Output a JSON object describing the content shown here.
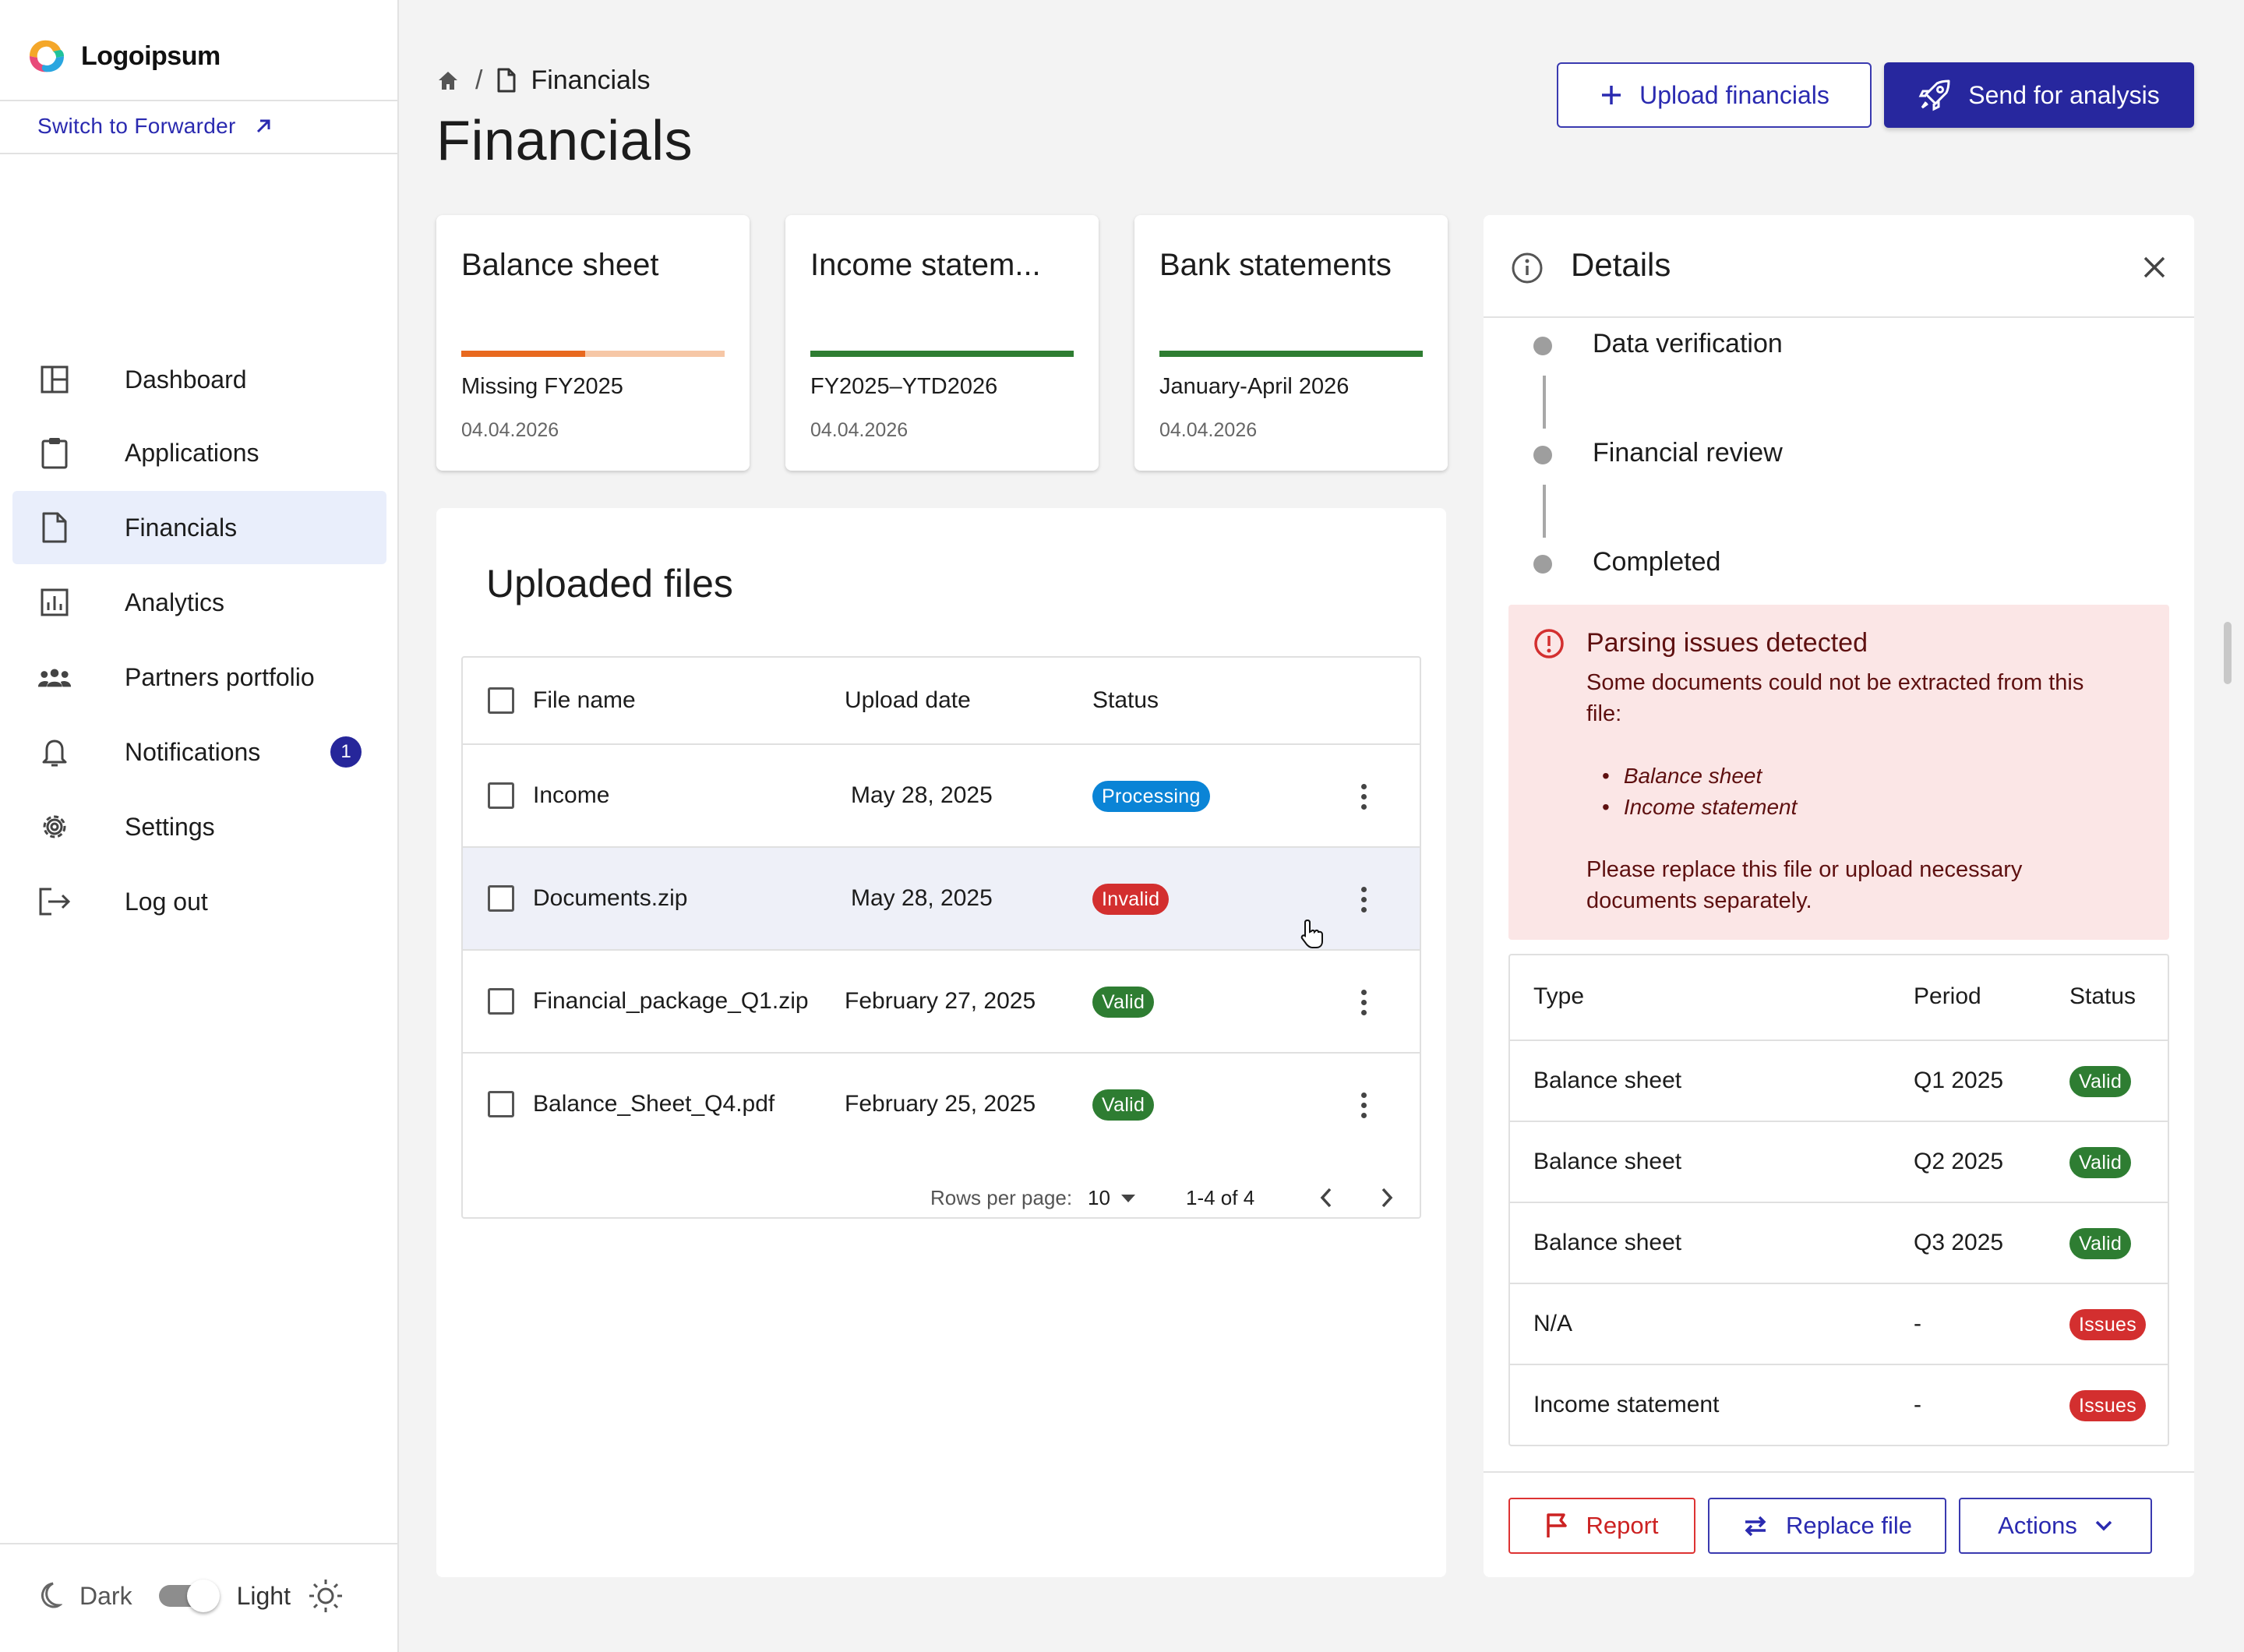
{
  "brand": {
    "name": "Logoipsum",
    "switch_label": "Switch to Forwarder"
  },
  "sidebar": {
    "items": [
      {
        "label": "Dashboard",
        "icon": "dashboard-icon"
      },
      {
        "label": "Applications",
        "icon": "clipboard-icon"
      },
      {
        "label": "Financials",
        "icon": "document-icon",
        "active": true
      },
      {
        "label": "Analytics",
        "icon": "bar-chart-icon"
      },
      {
        "label": "Partners portfolio",
        "icon": "group-icon"
      },
      {
        "label": "Notifications",
        "icon": "bell-icon",
        "badge": "1"
      },
      {
        "label": "Settings",
        "icon": "gear-icon"
      },
      {
        "label": "Log out",
        "icon": "logout-icon"
      }
    ],
    "theme": {
      "dark_label": "Dark",
      "light_label": "Light",
      "mode": "light"
    }
  },
  "header": {
    "breadcrumb_sep": "/",
    "breadcrumb_current": "Financials",
    "title": "Financials",
    "upload_label": "Upload financials",
    "send_label": "Send for analysis"
  },
  "cards": [
    {
      "title": "Balance sheet",
      "subtitle": "Missing FY2025",
      "date": "04.04.2026",
      "progress": 0.47,
      "color": "#e8691f",
      "track": "#f6c7a6"
    },
    {
      "title": "Income statem...",
      "subtitle": "FY2025–YTD2026",
      "date": "04.04.2026",
      "progress": 1.0,
      "color": "#2e7d32",
      "track": "#2e7d32"
    },
    {
      "title": "Bank statements",
      "subtitle": "January-April 2026",
      "date": "04.04.2026",
      "progress": 1.0,
      "color": "#2e7d32",
      "track": "#2e7d32"
    }
  ],
  "files": {
    "title": "Uploaded files",
    "columns": {
      "name": "File name",
      "date": "Upload date",
      "status": "Status"
    },
    "rows": [
      {
        "name": "Income",
        "date": "May 28, 2025",
        "status": "Processing",
        "status_color": "#0a84d6"
      },
      {
        "name": "Documents.zip",
        "date": "May 28, 2025",
        "status": "Invalid",
        "status_color": "#d32f2f"
      },
      {
        "name": "Financial_package_Q1.zip",
        "date": "February 27, 2025",
        "status": "Valid",
        "status_color": "#2e7d32"
      },
      {
        "name": "Balance_Sheet_Q4.pdf",
        "date": "February 25, 2025",
        "status": "Valid",
        "status_color": "#2e7d32"
      }
    ],
    "pager": {
      "rows_per_page_label": "Rows per page:",
      "rows_per_page": "10",
      "range": "1-4 of 4"
    }
  },
  "details": {
    "title": "Details",
    "steps": [
      "Data verification",
      "Financial review",
      "Completed"
    ],
    "alert": {
      "title": "Parsing issues detected",
      "text_line1": "Some documents could not be extracted from this",
      "text_line2": "file:",
      "items": [
        "Balance sheet",
        "Income statement"
      ],
      "footer_line1": "Please replace this file or upload necessary",
      "footer_line2": "documents separately."
    },
    "table": {
      "columns": {
        "type": "Type",
        "period": "Period",
        "status": "Status"
      },
      "rows": [
        {
          "type": "Balance sheet",
          "period": "Q1 2025",
          "status": "Valid",
          "status_color": "#2e7d32"
        },
        {
          "type": "Balance sheet",
          "period": "Q2 2025",
          "status": "Valid",
          "status_color": "#2e7d32"
        },
        {
          "type": "Balance sheet",
          "period": "Q3 2025",
          "status": "Valid",
          "status_color": "#2e7d32"
        },
        {
          "type": "N/A",
          "period": "-",
          "status": "Issues",
          "status_color": "#d32f2f"
        },
        {
          "type": "Income statement",
          "period": "-",
          "status": "Issues",
          "status_color": "#d32f2f"
        }
      ]
    },
    "actions": {
      "report": "Report",
      "replace": "Replace file",
      "more": "Actions"
    }
  }
}
